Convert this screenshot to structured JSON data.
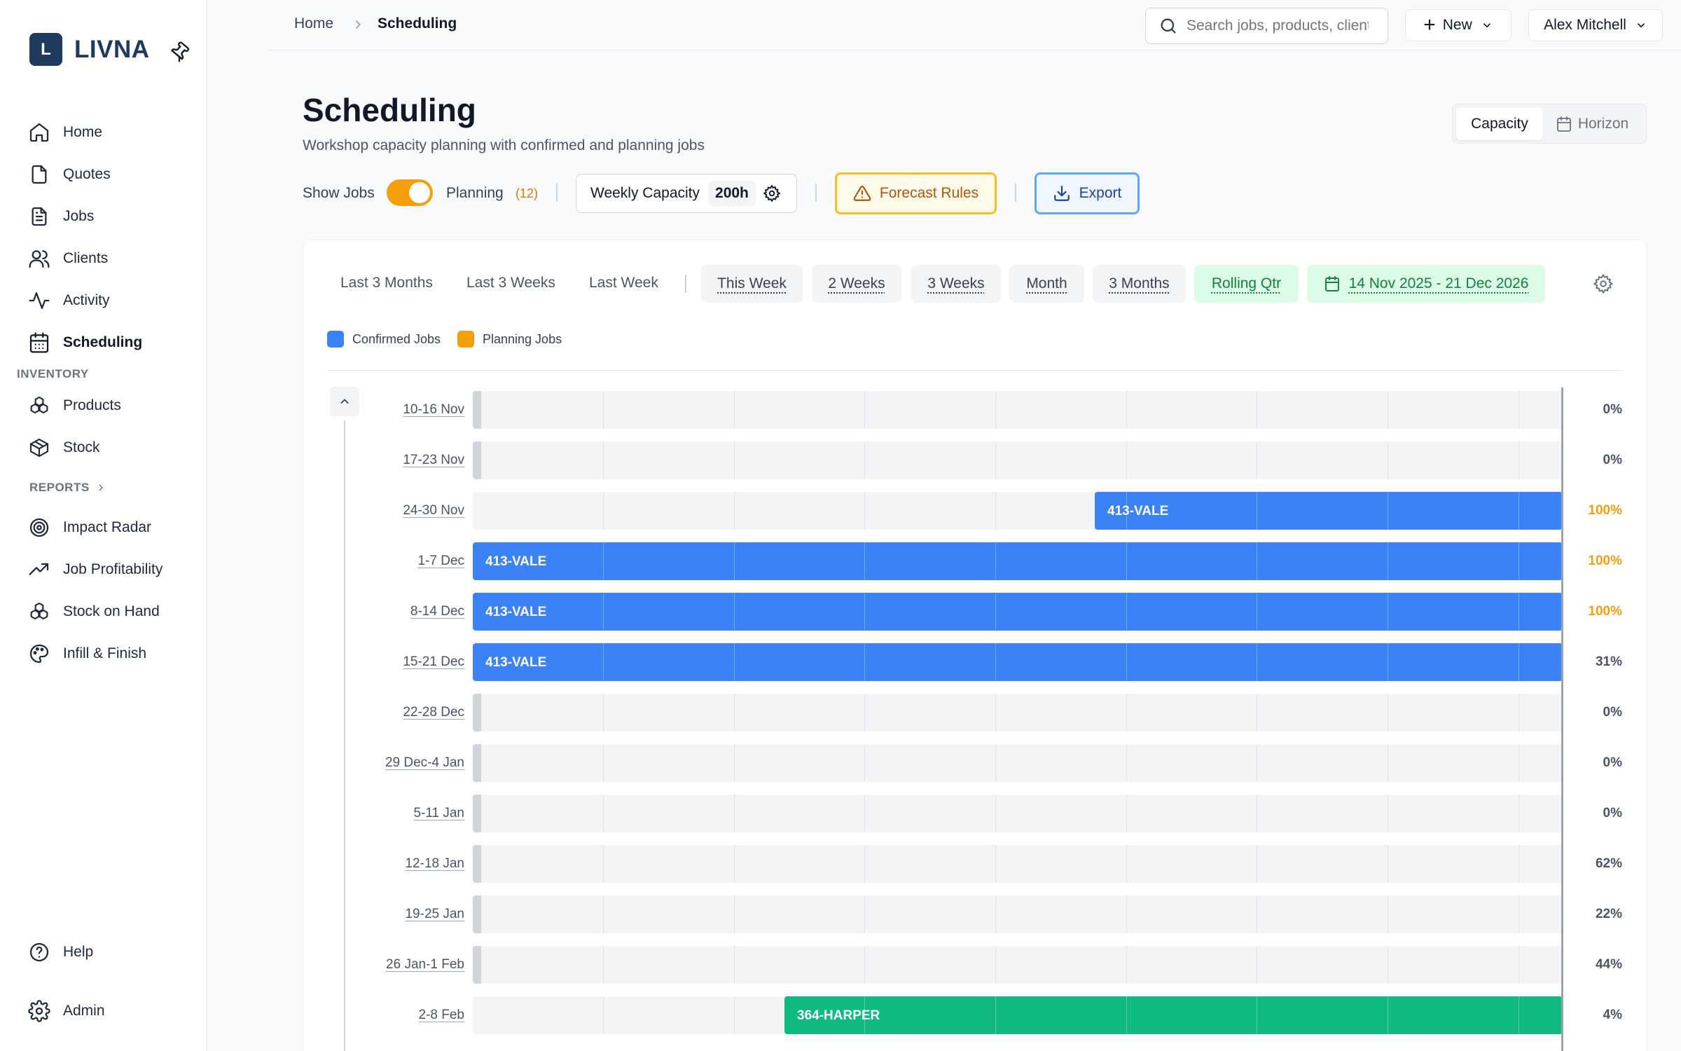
{
  "brand": {
    "initial": "L",
    "name": "LIVNA"
  },
  "sidebar": {
    "items": [
      {
        "label": "Home",
        "icon": "home-icon"
      },
      {
        "label": "Quotes",
        "icon": "file-icon"
      },
      {
        "label": "Jobs",
        "icon": "clipboard-icon"
      },
      {
        "label": "Clients",
        "icon": "users-icon"
      },
      {
        "label": "Activity",
        "icon": "activity-icon"
      },
      {
        "label": "Scheduling",
        "icon": "calendar-icon",
        "active": true
      }
    ],
    "inventory_heading": "INVENTORY",
    "inventory_items": [
      {
        "label": "Products",
        "icon": "boxes-icon"
      },
      {
        "label": "Stock",
        "icon": "package-icon"
      }
    ],
    "reports_heading": "REPORTS",
    "reports_items": [
      {
        "label": "Impact Radar",
        "icon": "target-icon"
      },
      {
        "label": "Job Profitability",
        "icon": "trending-up-icon"
      },
      {
        "label": "Stock on Hand",
        "icon": "boxes-icon"
      },
      {
        "label": "Infill & Finish",
        "icon": "palette-icon"
      }
    ],
    "help": "Help",
    "admin": "Admin"
  },
  "topbar": {
    "crumb_home": "Home",
    "crumb_current": "Scheduling",
    "search_placeholder": "Search jobs, products, clients",
    "new_label": "New",
    "user_name": "Alex Mitchell"
  },
  "page": {
    "title": "Scheduling",
    "subtitle": "Workshop capacity planning with confirmed and planning jobs",
    "view_capacity": "Capacity",
    "view_horizon": "Horizon"
  },
  "controls": {
    "show_jobs": "Show Jobs",
    "show_jobs_on": true,
    "planning": "Planning",
    "planning_count": "(12)",
    "weekly_capacity_label": "Weekly Capacity",
    "weekly_capacity_value": "200h",
    "forecast_rules": "Forecast Rules",
    "export": "Export"
  },
  "ranges": {
    "past": [
      "Last 3 Months",
      "Last 3 Weeks",
      "Last Week"
    ],
    "presets": [
      "This Week",
      "2 Weeks",
      "3 Weeks",
      "Month",
      "3 Months",
      "Rolling Qtr"
    ],
    "active": "Rolling Qtr",
    "date_range": "14 Nov 2025 - 21 Dec 2026"
  },
  "legend": {
    "confirmed": "Confirmed Jobs",
    "planning": "Planning Jobs"
  },
  "colors": {
    "confirmed": "#3b82f6",
    "planning": "#f59e0b",
    "alt_job": "#10b981",
    "accent": "#1e3a5f"
  },
  "weeks": [
    {
      "label": "10-16 Nov",
      "pct": "0%",
      "bar": null
    },
    {
      "label": "17-23 Nov",
      "pct": "0%",
      "bar": null
    },
    {
      "label": "24-30 Nov",
      "pct": "100%",
      "bar": {
        "job": "413-VALE",
        "start": 0.571,
        "end": 1.0,
        "color": "#3b82f6"
      }
    },
    {
      "label": "1-7 Dec",
      "pct": "100%",
      "bar": {
        "job": "413-VALE",
        "start": 0.0,
        "end": 1.0,
        "color": "#3b82f6"
      }
    },
    {
      "label": "8-14 Dec",
      "pct": "100%",
      "bar": {
        "job": "413-VALE",
        "start": 0.0,
        "end": 1.0,
        "color": "#3b82f6"
      }
    },
    {
      "label": "15-21 Dec",
      "pct": "31%",
      "bar": {
        "job": "413-VALE",
        "start": 0.0,
        "end": 1.0,
        "color": "#3b82f6"
      }
    },
    {
      "label": "22-28 Dec",
      "pct": "0%",
      "bar": null
    },
    {
      "label": "29 Dec-4 Jan",
      "pct": "0%",
      "bar": null
    },
    {
      "label": "5-11 Jan",
      "pct": "0%",
      "bar": null
    },
    {
      "label": "12-18 Jan",
      "pct": "62%",
      "bar": null
    },
    {
      "label": "19-25 Jan",
      "pct": "22%",
      "bar": null
    },
    {
      "label": "26 Jan-1 Feb",
      "pct": "44%",
      "bar": null
    },
    {
      "label": "2-8 Feb",
      "pct": "4%",
      "bar": {
        "job": "364-HARPER",
        "start": 0.286,
        "end": 1.0,
        "color": "#10b981"
      }
    }
  ]
}
